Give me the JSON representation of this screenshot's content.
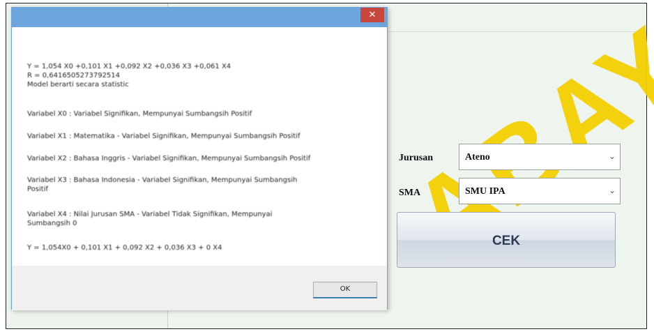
{
  "watermark": "ABAYA",
  "form": {
    "jurusan_label": "Jurusan",
    "jurusan_value": "Ateno",
    "sma_label": "SMA",
    "sma_value": "SMU IPA",
    "cek_label": "CEK"
  },
  "dialog": {
    "close_glyph": "✕",
    "lines": [
      "Y = 1,054 X0 +0,101 X1 +0,092 X2 +0,036 X3 +0,061 X4\nR = 0,6416505273792514\nModel berarti secara statistic",
      "Variabel X0 : Variabel Signifikan, Mempunyai Sumbangsih Positif",
      "Variabel X1 : Matematika - Variabel Signifikan, Mempunyai Sumbangsih Positif",
      "Variabel X2 : Bahasa Inggris - Variabel Signifikan, Mempunyai Sumbangsih Positif",
      "Variabel X3 : Bahasa Indonesia - Variabel Signifikan, Mempunyai Sumbangsih\nPositif",
      "Variabel X4 : Nilai Jurusan SMA - Variabel Tidak Signifikan, Mempunyai\nSumbangsih 0",
      "Y = 1,054X0 + 0,101 X1 + 0,092 X2 + 0,036 X3 + 0 X4"
    ],
    "ok_label": "OK"
  }
}
